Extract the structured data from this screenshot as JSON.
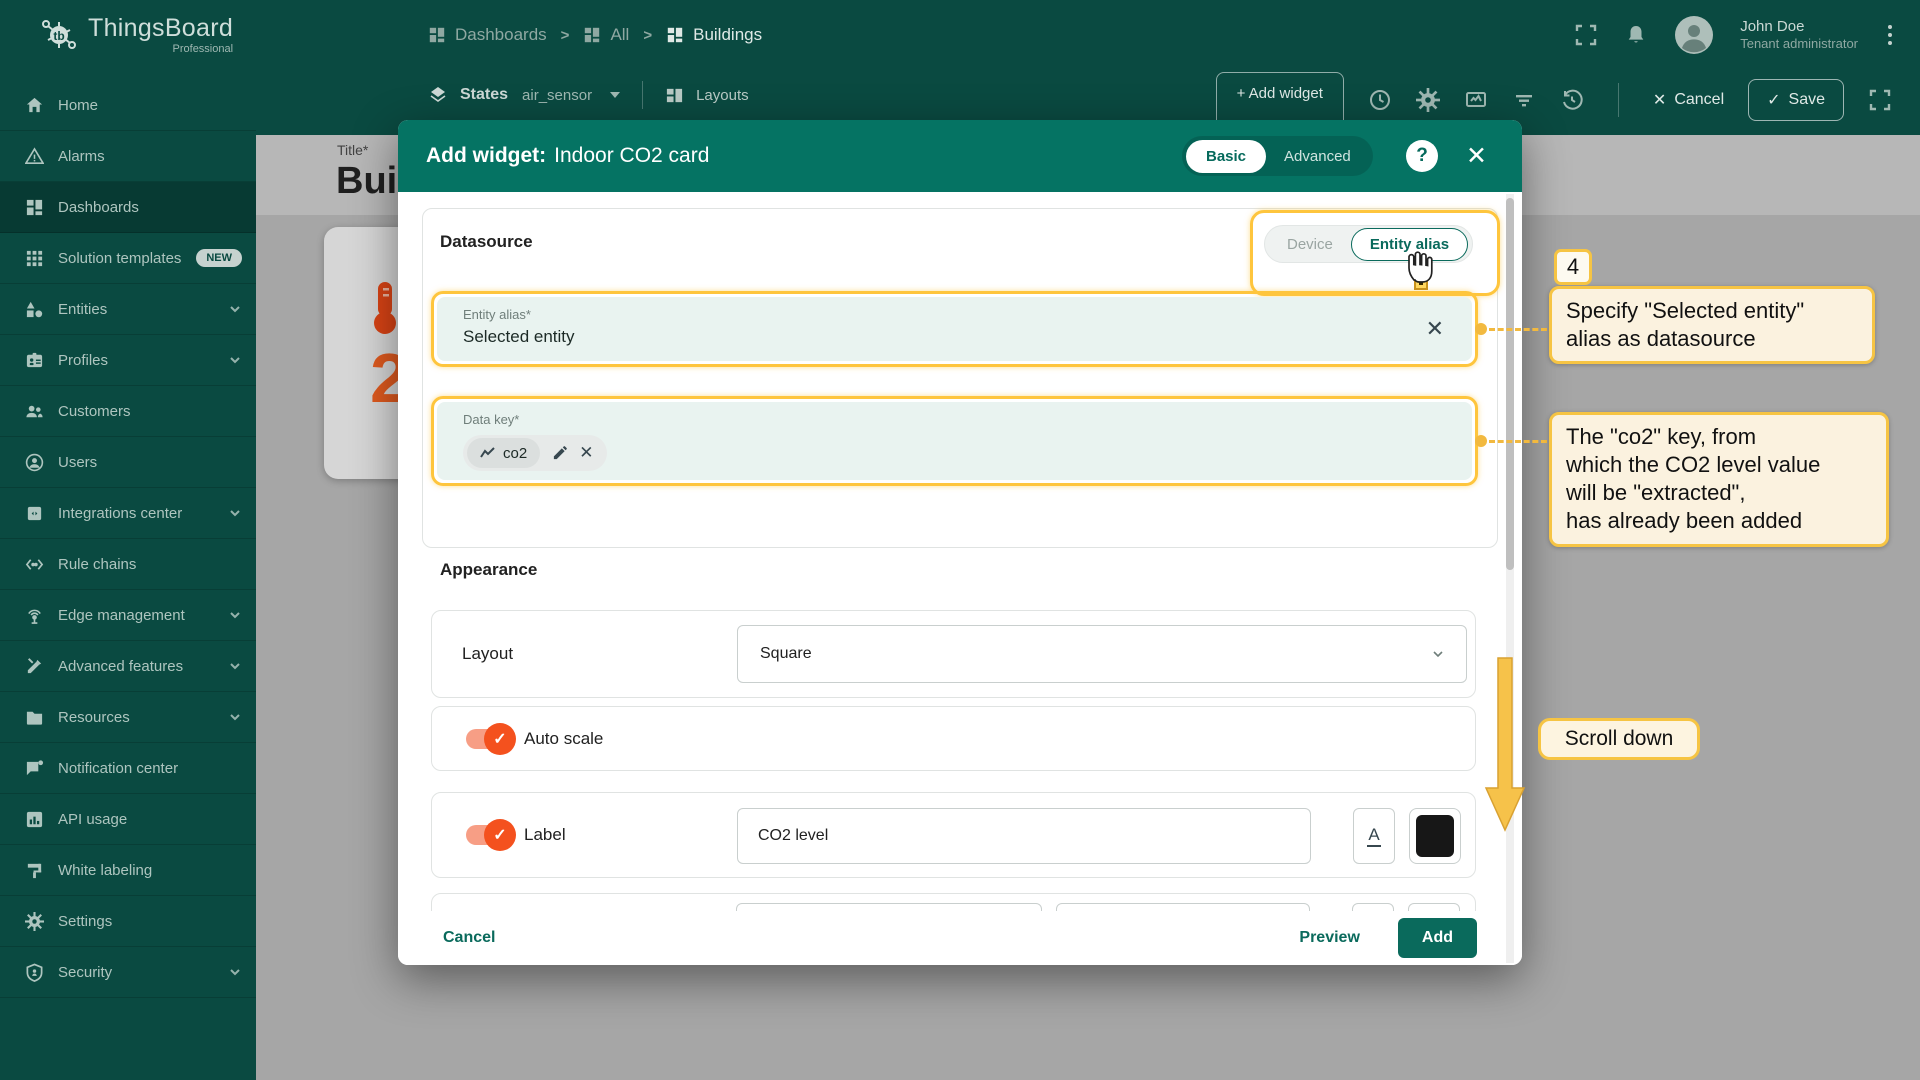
{
  "app": {
    "name": "ThingsBoard",
    "edition": "Professional"
  },
  "sidebar": {
    "items": [
      {
        "label": "Home"
      },
      {
        "label": "Alarms"
      },
      {
        "label": "Dashboards"
      },
      {
        "label": "Solution templates",
        "badge": "NEW"
      },
      {
        "label": "Entities"
      },
      {
        "label": "Profiles"
      },
      {
        "label": "Customers"
      },
      {
        "label": "Users"
      },
      {
        "label": "Integrations center"
      },
      {
        "label": "Rule chains"
      },
      {
        "label": "Edge management"
      },
      {
        "label": "Advanced features"
      },
      {
        "label": "Resources"
      },
      {
        "label": "Notification center"
      },
      {
        "label": "API usage"
      },
      {
        "label": "White labeling"
      },
      {
        "label": "Settings"
      },
      {
        "label": "Security"
      }
    ]
  },
  "breadcrumb": {
    "items": [
      {
        "label": "Dashboards"
      },
      {
        "label": "All"
      },
      {
        "label": "Buildings"
      }
    ],
    "separator": ">"
  },
  "user": {
    "name": "John Doe",
    "role": "Tenant administrator"
  },
  "toolbar": {
    "states_label": "States",
    "state_value": "air_sensor",
    "layouts_label": "Layouts",
    "add_widget_label": "+ Add widget",
    "cancel_label": "Cancel",
    "save_label": "Save",
    "cancel_x": "✕",
    "save_check": "✓"
  },
  "page": {
    "title_label": "Title*",
    "title_value": "Bui",
    "widget_value": "2"
  },
  "modal": {
    "title_prefix": "Add widget:",
    "title_name": "Indoor CO2 card",
    "mode_basic": "Basic",
    "mode_advanced": "Advanced",
    "help": "?",
    "close": "✕",
    "datasource": {
      "heading": "Datasource",
      "toggle_device": "Device",
      "toggle_entity_alias": "Entity alias",
      "entity_alias_label": "Entity alias*",
      "entity_alias_value": "Selected entity",
      "clear": "✕",
      "data_key_label": "Data key*",
      "data_key_chip": "co2"
    },
    "appearance": {
      "heading": "Appearance",
      "layout_label": "Layout",
      "layout_value": "Square",
      "auto_scale_label": "Auto scale",
      "label_label": "Label",
      "label_value": "CO2 level",
      "font_button": "A",
      "check": "✓"
    },
    "footer": {
      "cancel": "Cancel",
      "preview": "Preview",
      "add": "Add"
    }
  },
  "annotations": {
    "step": "4",
    "callout_alias": "Specify \"Selected entity\"\nalias as datasource",
    "callout_datakey": "The \"co2\" key, from\nwhich the CO2 level value\nwill be \"extracted\",\nhas already been added",
    "scroll": "Scroll down"
  },
  "colors": {
    "sidebar_teal": "#0a4a41",
    "modal_header_teal": "#057363",
    "accent_teal": "#0a6a5c",
    "highlight_yellow": "#fec53d",
    "callout_cream": "#fbf2df",
    "toggle_orange": "#f4511e",
    "value_orange": "#df5a1f"
  }
}
